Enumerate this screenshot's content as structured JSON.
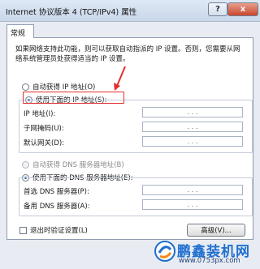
{
  "window": {
    "title": "Internet 协议版本 4 (TCP/IPv4) 属性",
    "help_label": "?",
    "close_label": "x"
  },
  "tabs": [
    {
      "label": "常规"
    }
  ],
  "intro": "如果网络支持此功能，则可以获取自动指派的 IP 设置。否则，您需要从网络系统管理员处获得适当的 IP 设置。",
  "ip_section": {
    "auto_label": "自动获得 IP 地址(O)",
    "manual_label": "使用下面的 IP 地址(S):",
    "fields": [
      {
        "label": "IP 地址(I):",
        "value": ". . ."
      },
      {
        "label": "子网掩码(U):",
        "value": ". . ."
      },
      {
        "label": "默认网关(D):",
        "value": ". . ."
      }
    ]
  },
  "dns_section": {
    "auto_label": "自动获得 DNS 服务器地址(B)",
    "manual_label": "使用下面的 DNS 服务器地址(E):",
    "fields": [
      {
        "label": "首选 DNS 服务器(P):",
        "value": ". . ."
      },
      {
        "label": "备用 DNS 服务器(A):",
        "value": ". . ."
      }
    ]
  },
  "validate_label": "退出时验证设置(L)",
  "advanced_button": "高级(V)...",
  "watermark": {
    "title": "鹏鑫装机网",
    "url": "www.0753px.com"
  },
  "colors": {
    "highlight": "#e03030",
    "accent": "#1f6fd0"
  }
}
